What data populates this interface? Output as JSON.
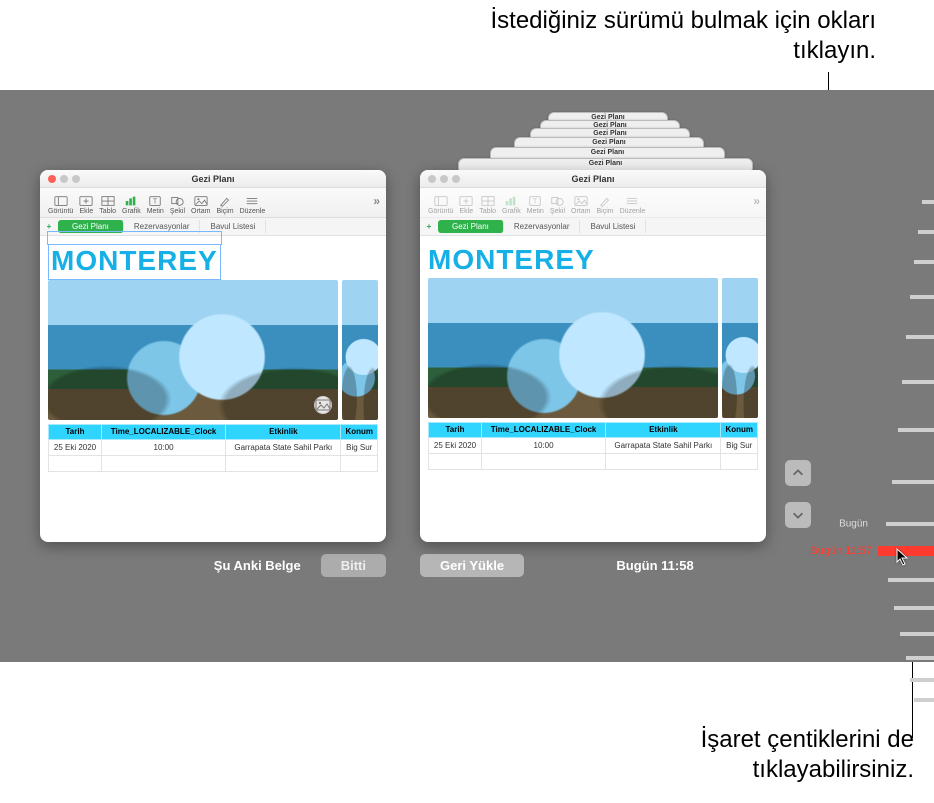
{
  "annotations": {
    "top": "İstediğiniz sürümü bulmak için okları tıklayın.",
    "bottom": "İşaret çentiklerini de tıklayabilirsiniz."
  },
  "window": {
    "title": "Gezi Planı",
    "toolbar": [
      {
        "label": "Görüntü",
        "icon": "view-icon"
      },
      {
        "label": "Ekle",
        "icon": "insert-icon"
      },
      {
        "label": "Tablo",
        "icon": "table-icon"
      },
      {
        "label": "Grafik",
        "icon": "chart-icon"
      },
      {
        "label": "Metin",
        "icon": "text-icon"
      },
      {
        "label": "Şekil",
        "icon": "shape-icon"
      },
      {
        "label": "Ortam",
        "icon": "media-icon"
      },
      {
        "label": "Biçim",
        "icon": "format-icon"
      },
      {
        "label": "Düzenle",
        "icon": "organize-icon"
      }
    ],
    "sheets": {
      "add_label": "+",
      "items": [
        "Gezi Planı",
        "Rezervasyonlar",
        "Bavul Listesi"
      ],
      "active_index": 0
    }
  },
  "document": {
    "title": "MONTEREY",
    "table": {
      "headers": [
        "Tarih",
        "Time_LOCALIZABLE_Clock",
        "Etkinlik",
        "Konum"
      ],
      "rows": [
        [
          "25 Eki 2020",
          "10:00",
          "Garrapata State Sahil Parkı",
          "Big Sur"
        ]
      ]
    }
  },
  "footer": {
    "current_label": "Şu Anki Belge",
    "done_label": "Bitti",
    "restore_label": "Geri Yükle",
    "version_label": "Bugün 11:58"
  },
  "timeline": {
    "today_label": "Bugün",
    "active_label": "Bugün 11:57"
  }
}
